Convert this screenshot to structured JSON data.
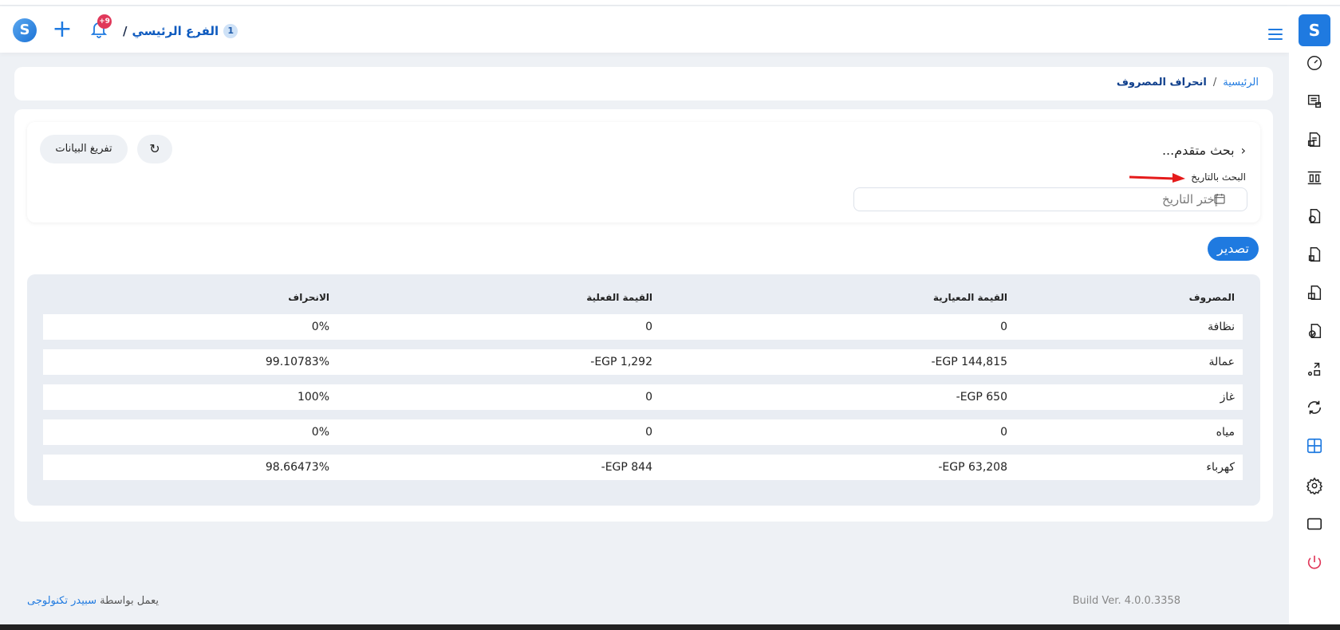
{
  "header": {
    "branch_name": "الفرع الرئيسي",
    "branch_count": "1",
    "branch_slash": "/",
    "notification_badge": "+9"
  },
  "breadcrumb": {
    "home": "الرئيسية",
    "separator": "/",
    "current": "انحراف المصروف"
  },
  "search": {
    "title": "بحث متقدم...",
    "date_label": "البحث بالتاريخ",
    "date_placeholder": "إختر التاريخ",
    "clear_button": "تفريغ البيانات"
  },
  "export_button": "تصدير",
  "table": {
    "headers": [
      "المصروف",
      "القيمة المعيارية",
      "القيمة الفعلية",
      "الانحراف"
    ],
    "rows": [
      [
        "نظافة",
        "0",
        "0",
        "0%"
      ],
      [
        "عمالة",
        "EGP 144,815-",
        "EGP 1,292-",
        "99.10783%"
      ],
      [
        "غاز",
        "EGP 650-",
        "0",
        "100%"
      ],
      [
        "مياه",
        "0",
        "0",
        "0%"
      ],
      [
        "كهرباء",
        "EGP 63,208-",
        "EGP 844-",
        "98.66473%"
      ]
    ]
  },
  "footer": {
    "powered_by": "يعمل بواسطة",
    "company": "سبيدر تكنولوجى",
    "version": "Build Ver. 4.0.0.3358"
  },
  "colors": {
    "accent": "#1f7ae0",
    "badge": "#e0385a"
  }
}
